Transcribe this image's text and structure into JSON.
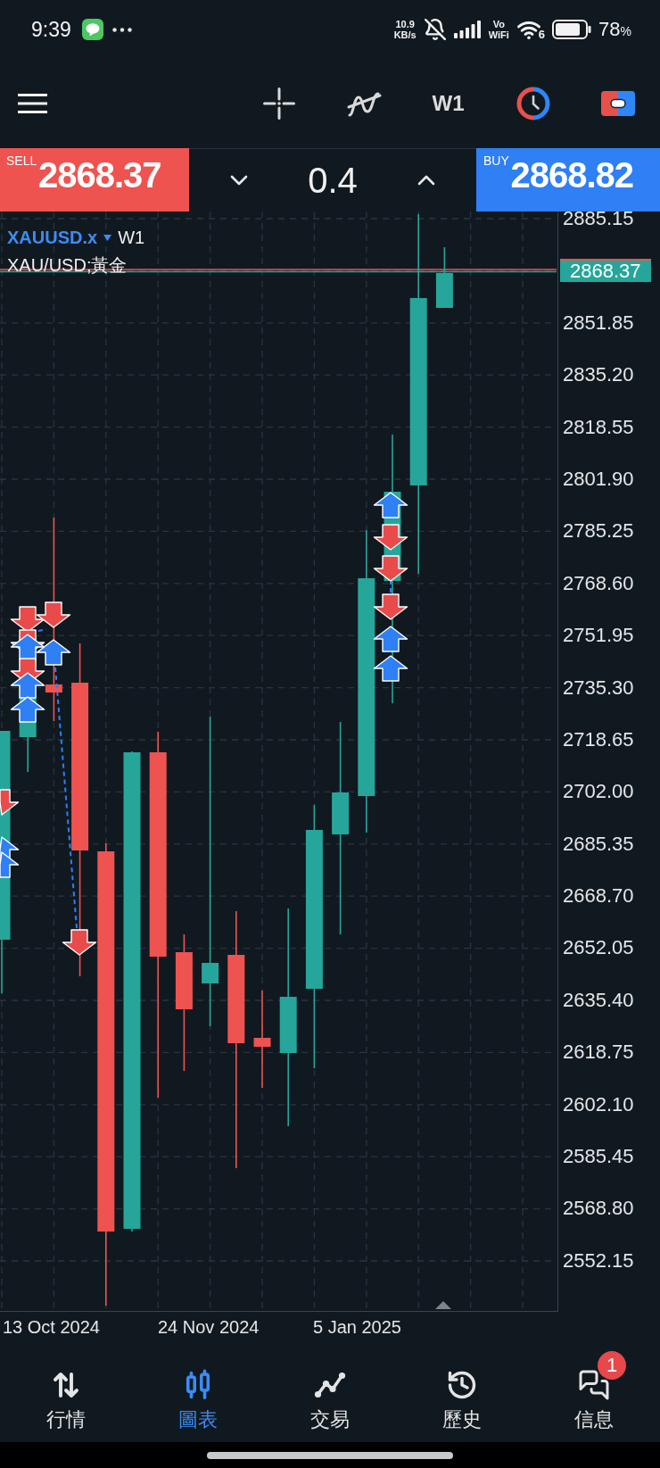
{
  "status_bar": {
    "time": "9:39",
    "network_speed": "10.9",
    "network_speed_unit": "KB/s",
    "vowifi": [
      "Vo",
      "WiFi"
    ],
    "wifi_generation": "6",
    "battery_percent": "78",
    "battery_unit": "%"
  },
  "toolbar": {
    "timeframe": "W1"
  },
  "trade_bar": {
    "sell": {
      "label": "SELL",
      "price": "2868.37"
    },
    "volume": "0.4",
    "buy": {
      "label": "BUY",
      "price": "2868.82"
    }
  },
  "chart": {
    "symbol": "XAUUSD.x",
    "timeframe": "W1",
    "description": "XAU/USD;黃金",
    "price_axis": [
      {
        "kind": "tick",
        "label": "2885.15"
      },
      {
        "kind": "current",
        "label": "2868.37"
      },
      {
        "kind": "tick",
        "label": "2851.85"
      },
      {
        "kind": "tick",
        "label": "2835.20"
      },
      {
        "kind": "tick",
        "label": "2818.55"
      },
      {
        "kind": "tick",
        "label": "2801.90"
      },
      {
        "kind": "tick",
        "label": "2785.25"
      },
      {
        "kind": "tick",
        "label": "2768.60"
      },
      {
        "kind": "tick",
        "label": "2751.95"
      },
      {
        "kind": "tick",
        "label": "2735.30"
      },
      {
        "kind": "tick",
        "label": "2718.65"
      },
      {
        "kind": "tick",
        "label": "2702.00"
      },
      {
        "kind": "tick",
        "label": "2685.35"
      },
      {
        "kind": "tick",
        "label": "2668.70"
      },
      {
        "kind": "tick",
        "label": "2652.05"
      },
      {
        "kind": "tick",
        "label": "2635.40"
      },
      {
        "kind": "tick",
        "label": "2618.75"
      },
      {
        "kind": "tick",
        "label": "2602.10"
      },
      {
        "kind": "tick",
        "label": "2585.45"
      },
      {
        "kind": "tick",
        "label": "2568.80"
      },
      {
        "kind": "tick",
        "label": "2552.15"
      }
    ],
    "time_axis": [
      "13 Oct 2024",
      "24 Nov 2024",
      "5 Jan 2025"
    ]
  },
  "bottom_nav": [
    {
      "label": "行情",
      "selected": false
    },
    {
      "label": "圖表",
      "selected": true
    },
    {
      "label": "交易",
      "selected": false
    },
    {
      "label": "歷史",
      "selected": false
    },
    {
      "label": "信息",
      "selected": false,
      "badge": "1"
    }
  ]
}
